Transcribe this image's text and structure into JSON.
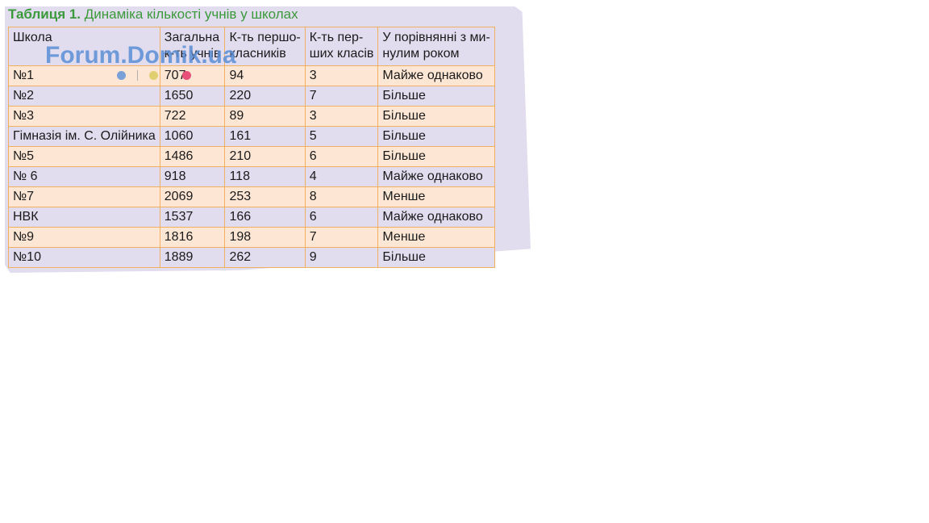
{
  "caption": {
    "number": "Таблиця 1.",
    "title": "Динаміка кількості учнів у школах"
  },
  "watermark": "Forum.Domik.ua",
  "table": {
    "headers": [
      [
        "Школа",
        ""
      ],
      [
        "Загальна",
        "к-ть учнів"
      ],
      [
        "К-ть першо-",
        "класників"
      ],
      [
        "К-ть пер-",
        "ших класів"
      ],
      [
        "У порівнянні з ми-",
        "нулим роком"
      ]
    ],
    "rows": [
      [
        "№1",
        "707",
        "94",
        "3",
        "Майже однаково"
      ],
      [
        "№2",
        "1650",
        "220",
        "7",
        "Більше"
      ],
      [
        "№3",
        "722",
        "89",
        "3",
        "Більше"
      ],
      [
        "Гімназія ім. С. Олійника",
        "1060",
        "161",
        "5",
        "Більше"
      ],
      [
        "№5",
        "1486",
        "210",
        "6",
        "Більше"
      ],
      [
        "№ 6",
        "918",
        "118",
        "4",
        "Майже однаково"
      ],
      [
        "№7",
        "2069",
        "253",
        "8",
        "Менше"
      ],
      [
        "НВК",
        "1537",
        "166",
        "6",
        "Майже однаково"
      ],
      [
        "№9",
        "1816",
        "198",
        "7",
        "Менше"
      ],
      [
        "№10",
        "1889",
        "262",
        "9",
        "Більше"
      ]
    ]
  },
  "colors": {
    "caption_green": "#3a9a3a",
    "border_orange": "#f0b060",
    "row_peach": "#fde6d4",
    "row_lavender": "#e2dcef",
    "watermark_blue": "#5b8fd6"
  }
}
